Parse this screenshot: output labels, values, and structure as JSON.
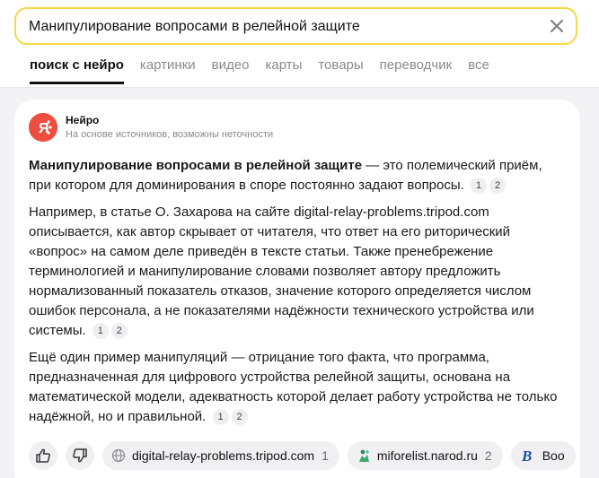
{
  "search": {
    "query": "Манипулирование вопросами в релейной защите",
    "clear_icon": "close-icon"
  },
  "tabs": [
    {
      "label": "поиск с нейро",
      "active": true
    },
    {
      "label": "картинки",
      "active": false
    },
    {
      "label": "видео",
      "active": false
    },
    {
      "label": "карты",
      "active": false
    },
    {
      "label": "товары",
      "active": false
    },
    {
      "label": "переводчик",
      "active": false
    },
    {
      "label": "все",
      "active": false
    }
  ],
  "neuro": {
    "name": "Нейро",
    "subtitle": "На основе источников, возможны неточности",
    "logo_color": "#ee4e3f",
    "logo_text": "Я"
  },
  "answer": {
    "p1": {
      "bold": "Манипулирование вопросами в релейной защите",
      "text": " — это полемический приём, при котором для доминирования в споре постоянно задают вопросы.",
      "cites": [
        "1",
        "2"
      ]
    },
    "p2": {
      "text": "Например, в статье О. Захарова на сайте digital-relay-problems.tripod.com описывается, как автор скрывает от читателя, что ответ на его риторический «вопрос» на самом деле приведён в тексте статьи. Также пренебрежение терминологией и манипулирование словами позволяет автору предложить нормализованный показатель отказов, значение которого определяется числом ошибок персонала, а не показателями надёжности технического устройства или системы.",
      "cites": [
        "1",
        "2"
      ]
    },
    "p3": {
      "text": "Ещё один пример манипуляций — отрицание того факта, что программа, предназначенная для цифрового устройства релейной защиты, основана на математической модели, адекватность которой делает работу устройства не только надёжной, но и правильной.",
      "cites": [
        "1",
        "2"
      ]
    }
  },
  "sources": [
    {
      "label": "digital-relay-problems.tripod.com",
      "num": "1",
      "icon": "globe-icon"
    },
    {
      "label": "miforelist.narod.ru",
      "num": "2",
      "icon": "narod-icon"
    },
    {
      "label": "Boo",
      "num": "",
      "icon": "b-letter-icon"
    }
  ],
  "feedback": {
    "like_icon": "thumbs-up-icon",
    "dislike_icon": "thumbs-down-icon"
  },
  "colors": {
    "accent": "#f5d84a",
    "brand": "#ee4e3f"
  }
}
